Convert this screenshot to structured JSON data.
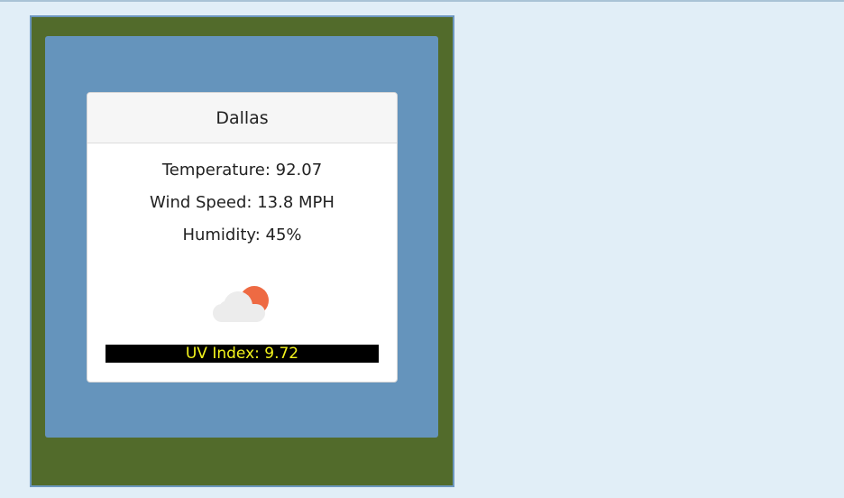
{
  "card": {
    "city": "Dallas",
    "temperature": "Temperature: 92.07",
    "wind_speed": "Wind Speed: 13.8 MPH",
    "humidity": "Humidity: 45%",
    "weather_icon": "partly-cloudy-icon",
    "uv_index": "UV Index: 9.72"
  },
  "colors": {
    "page_background": "#e1eef7",
    "outer_frame": "#526b2b",
    "inner_panel": "#6594bc",
    "uv_bar_background": "#000000",
    "uv_bar_text": "#f3f31d",
    "sun": "#ee6a43",
    "cloud": "#ececec"
  }
}
